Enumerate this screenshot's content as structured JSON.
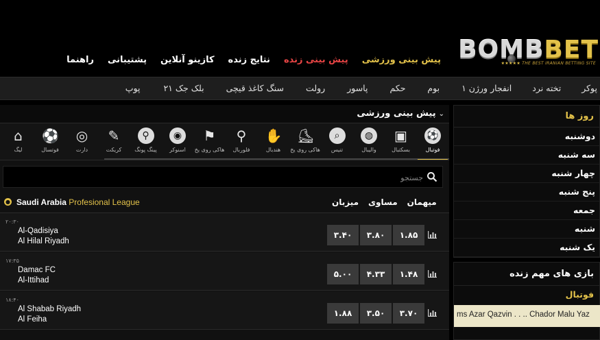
{
  "logo": {
    "bomb": "BOMB",
    "bet": "BET",
    "tagline": "THE BEST IRANIAN BETTING SITE",
    "stars": "★★★★★"
  },
  "main_nav": [
    {
      "label": "پیش بینی ورزشی",
      "style": "gold"
    },
    {
      "label": "پیش بینی زنده",
      "style": "red"
    },
    {
      "label": "نتایج زنده",
      "style": "white"
    },
    {
      "label": "کازینو آنلاین",
      "style": "white"
    },
    {
      "label": "پشتیبانی",
      "style": "white"
    },
    {
      "label": "راهنما",
      "style": "white"
    }
  ],
  "game_bar": [
    "پوکر",
    "تخته نرد",
    "انفجار ورژن ۱",
    "بوم",
    "حکم",
    "پاسور",
    "رولت",
    "سنگ کاغذ قیچی",
    "بلک جک ۲۱",
    "پوپ"
  ],
  "panel": {
    "title": "پیش بینی ورزشی",
    "search_placeholder": "جستجو"
  },
  "sports": [
    {
      "label": "فوتبال",
      "icon": "soccer-ball-icon",
      "active": true
    },
    {
      "label": "بسکتبال",
      "icon": "basketball-icon",
      "active": false
    },
    {
      "label": "والیبال",
      "icon": "volleyball-icon",
      "active": false
    },
    {
      "label": "تنیس",
      "icon": "tennis-icon",
      "active": false
    },
    {
      "label": "هاکی روی یخ",
      "icon": "ice-hockey-icon",
      "active": false
    },
    {
      "label": "هندبال",
      "icon": "handball-icon",
      "active": false
    },
    {
      "label": "فلوربال",
      "icon": "floorball-icon",
      "active": false
    },
    {
      "label": "هاکی روی یخ",
      "icon": "field-hockey-icon",
      "active": false
    },
    {
      "label": "اسنوکر",
      "icon": "snooker-icon",
      "active": false
    },
    {
      "label": "پینگ پونگ",
      "icon": "ping-pong-icon",
      "active": false
    },
    {
      "label": "کریکت",
      "icon": "cricket-icon",
      "active": false
    },
    {
      "label": "دارت",
      "icon": "darts-icon",
      "active": false
    },
    {
      "label": "فوتسال",
      "icon": "futsal-icon",
      "active": false
    },
    {
      "label": "لیگ",
      "icon": "league-icon",
      "active": false
    }
  ],
  "league": {
    "country": "Saudi Arabia",
    "name": "Profesional League",
    "columns": [
      "میهمان",
      "مساوی",
      "میزبان"
    ]
  },
  "matches": [
    {
      "time": "۲۰:۳۰",
      "home": "Al-Qadisiya",
      "away": "Al Hilal Riyadh",
      "odds": [
        "۳.۴۰",
        "۳.۸۰",
        "۱.۸۵"
      ]
    },
    {
      "time": "۱۷:۳۵",
      "home": "Damac FC",
      "away": "Al-Ittihad",
      "odds": [
        "۵.۰۰",
        "۴.۳۳",
        "۱.۴۸"
      ]
    },
    {
      "time": "۱۸:۴۰",
      "home": "Al Shabab Riyadh",
      "away": "Al Feiha",
      "odds": [
        "۱.۸۸",
        "۳.۵۰",
        "۳.۷۰"
      ]
    }
  ],
  "sidebar": {
    "days_title": "روز ها",
    "days": [
      "دوشنبه",
      "سه شنبه",
      "چهار شنبه",
      "پنج شنبه",
      "جمعه",
      "شنبه",
      "یک شنبه"
    ],
    "live_title": "بازی های مهم زنده",
    "live_sport": "فوتبال",
    "ticker": "ms Azar Qazvin  . .  ..  Chador Malu Yaz"
  },
  "colors": {
    "accent_gold": "#e3c24a",
    "live_red": "#e84545",
    "odds_bg": "#3a3a3a"
  }
}
